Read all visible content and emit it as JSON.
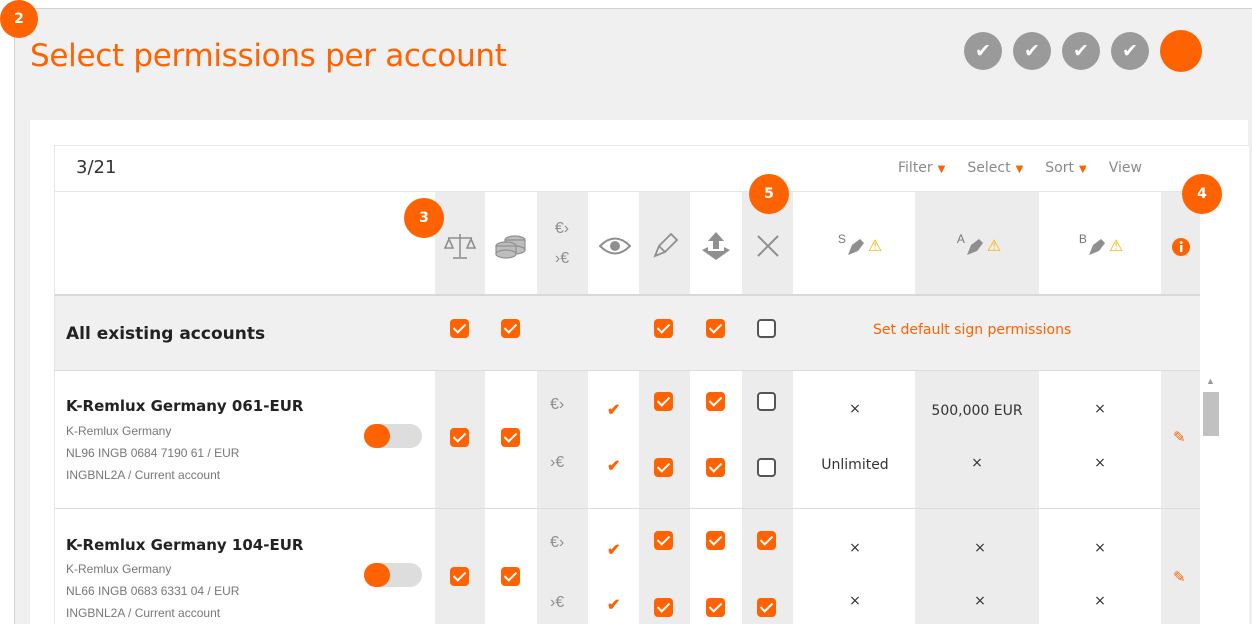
{
  "page": {
    "title": "Select permissions per account",
    "step_badge": "2"
  },
  "steps": [
    "✔",
    "✔",
    "✔",
    "✔",
    ""
  ],
  "annotations": {
    "col_badge_3": "3",
    "col_badge_4": "4",
    "col_badge_5": "5"
  },
  "toolbar": {
    "count": "3/21",
    "filter": "Filter",
    "select": "Select",
    "sort": "Sort",
    "view": "View"
  },
  "header_icons": {
    "balance": "balance-scale-icon",
    "coins": "coins-icon",
    "transfer": "euro-transfer-icon",
    "view": "eye-icon",
    "edit": "pencil-icon",
    "upload": "upload-icon",
    "cancel": "x-icon",
    "sign_s": "S",
    "sign_a": "A",
    "sign_b": "B",
    "info": "info-icon"
  },
  "all_accounts": {
    "label": "All existing accounts",
    "default_sign_link": "Set default sign permissions"
  },
  "accounts": [
    {
      "name": "K-Remlux Germany 061-EUR",
      "company": "K-Remlux Germany",
      "iban": "NL96 INGB 0684 7190 61 / EUR",
      "bic": "INGBNL2A / Current account",
      "s_row1": "×",
      "a_row1": "500,000 EUR",
      "b_row1": "×",
      "s_row2": "Unlimited",
      "a_row2": "×",
      "b_row2": "×"
    },
    {
      "name": "K-Remlux Germany 104-EUR",
      "company": "K-Remlux Germany",
      "iban": "NL66 INGB 0683 6331 04 / EUR",
      "bic": "INGBNL2A / Current account",
      "s_row1": "×",
      "a_row1": "×",
      "b_row1": "×",
      "s_row2": "×",
      "a_row2": "×",
      "b_row2": "×"
    }
  ],
  "colors": {
    "accent": "#ff6200",
    "step_done": "#9a9a9a",
    "warning": "#f5b400"
  }
}
